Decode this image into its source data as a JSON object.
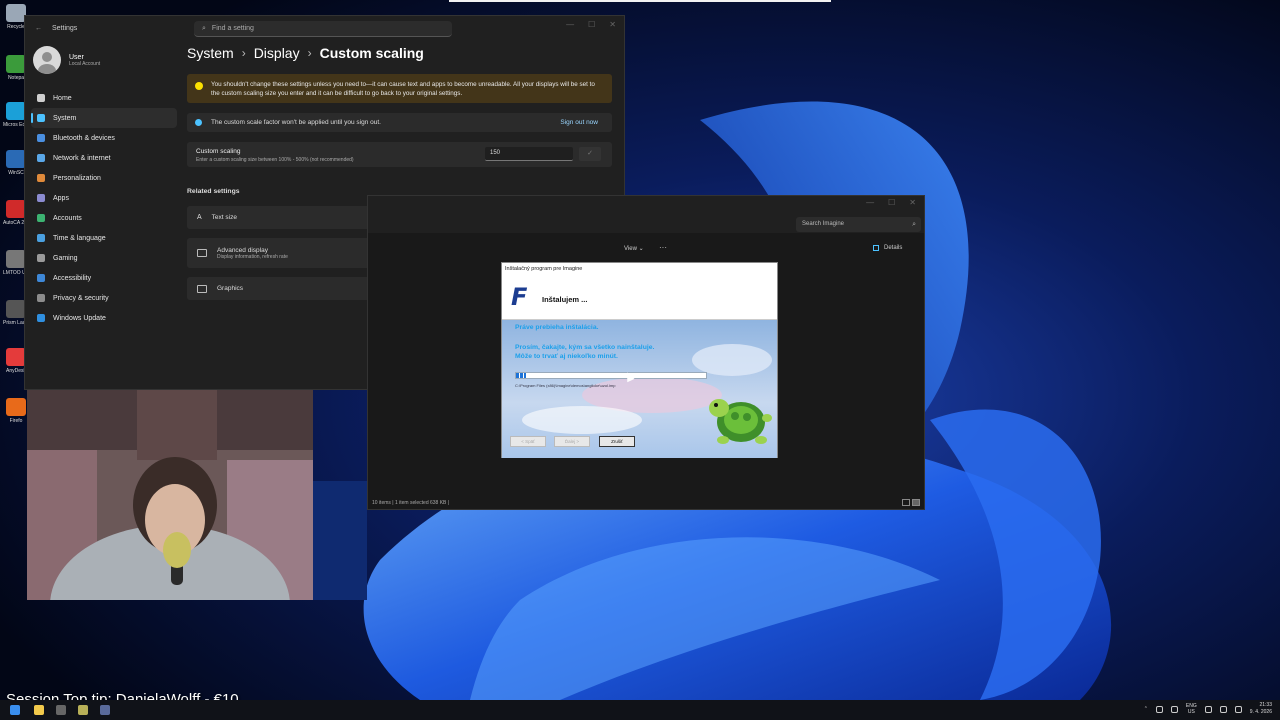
{
  "desktop": {
    "icons": [
      {
        "label": "Recycle",
        "color": "#9aa7b6"
      },
      {
        "label": "Notepa",
        "color": "#3b9b3b"
      },
      {
        "label": "Micros Edge",
        "color": "#1ba0d8"
      },
      {
        "label": "WinSC",
        "color": "#2a6ab5"
      },
      {
        "label": "AutoCA 2025 -",
        "color": "#d02a2a"
      },
      {
        "label": "LMTOO Utilit",
        "color": "#777777"
      },
      {
        "label": "Prism Launch",
        "color": "#555555"
      },
      {
        "label": "AnyDesk",
        "color": "#e43b3b"
      },
      {
        "label": "Firefo",
        "color": "#e86a1a"
      }
    ]
  },
  "settings": {
    "title": "Settings",
    "search_placeholder": "Find a setting",
    "user": {
      "name": "User",
      "account": "Local Account"
    },
    "nav": [
      {
        "label": "Home",
        "color": "#cfcfcf"
      },
      {
        "label": "System",
        "color": "#4cc2ff"
      },
      {
        "label": "Bluetooth & devices",
        "color": "#4a8fe0"
      },
      {
        "label": "Network & internet",
        "color": "#5aa7e8"
      },
      {
        "label": "Personalization",
        "color": "#e08a3a"
      },
      {
        "label": "Apps",
        "color": "#8b8bd0"
      },
      {
        "label": "Accounts",
        "color": "#3cb371"
      },
      {
        "label": "Time & language",
        "color": "#4aa0e0"
      },
      {
        "label": "Gaming",
        "color": "#9a9a9a"
      },
      {
        "label": "Accessibility",
        "color": "#3e88d8"
      },
      {
        "label": "Privacy & security",
        "color": "#8c8c8c"
      },
      {
        "label": "Windows Update",
        "color": "#2f8fe0"
      }
    ],
    "breadcrumb": {
      "part1": "System",
      "part2": "Display",
      "part3": "Custom scaling",
      "sep": "›"
    },
    "warning": "You shouldn't change these settings unless you need to—it can cause text and apps to become unreadable. All your displays will be set to the custom scaling size you enter and it can be difficult to go back to your original settings.",
    "info": {
      "text": "The custom scale factor won't be applied until you sign out.",
      "action": "Sign out now"
    },
    "custom_scaling": {
      "title": "Custom scaling",
      "subtitle": "Enter a custom scaling size between 100% - 500% (not recommended)",
      "value": "150",
      "check": "✓"
    },
    "related_title": "Related settings",
    "related": [
      {
        "label": "Text size",
        "sub": ""
      },
      {
        "label": "Advanced display",
        "sub": "Display information, refresh rate"
      },
      {
        "label": "Graphics",
        "sub": ""
      }
    ]
  },
  "explorer": {
    "search_placeholder": "Search Imagine",
    "toolbar_view": "View ⌄",
    "toolbar_more": "···",
    "details": "Details",
    "status": "10 items  |  1 item selected  638 KB  |"
  },
  "installer": {
    "window_title": "Inštalačný program pre Imagine",
    "logo": "F",
    "heading": "Inštalujem ...",
    "line1": "Práve prebieha inštalácia.",
    "line2": "Prosím, čakajte, kým sa všetko nainštaluje.",
    "line3": "Môže to trvať aj niekoľko minút.",
    "progress": 0.05,
    "path": "C:\\Program Files (x86)\\Imagine\\demos\\anglicke\\uzol.imp",
    "buttons": {
      "back": "< Späť",
      "next": "Ďalej >",
      "cancel": "Zrušiť"
    }
  },
  "overlay": {
    "tip": "Session Top tip: DanielaWolff - €10"
  },
  "taskbar": {
    "lang_top": "ENG",
    "lang_bottom": "US",
    "time": "21:33",
    "date": "9. 4. 2026"
  }
}
